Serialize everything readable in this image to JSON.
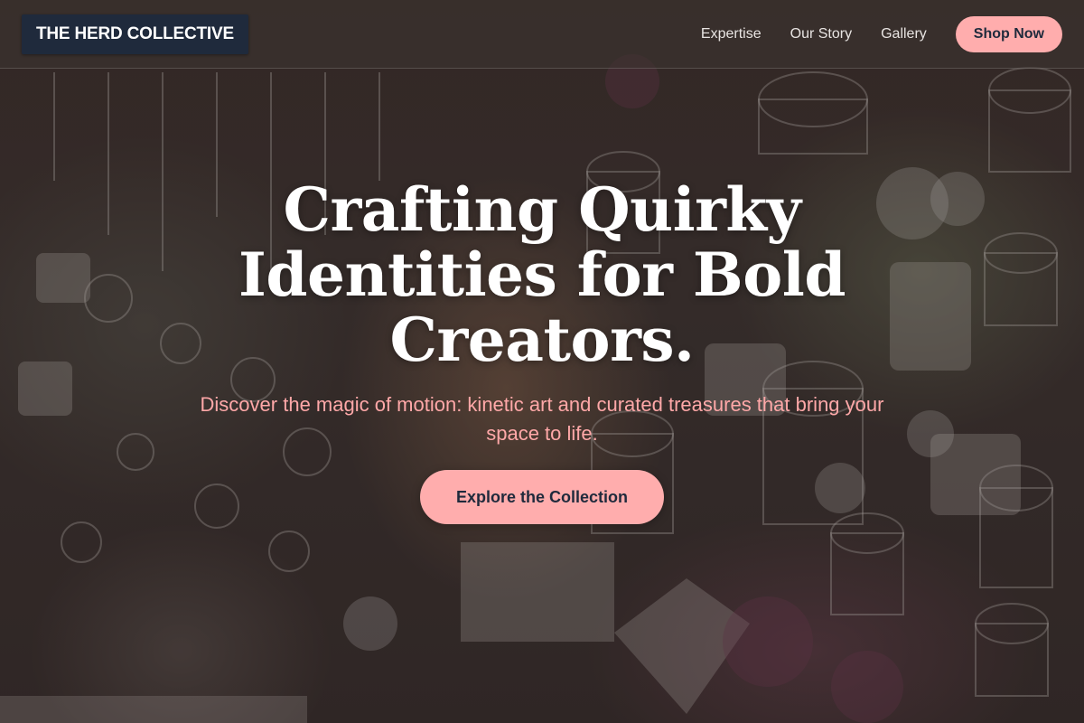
{
  "brand": {
    "name": "THE HERD COLLECTIVE",
    "accent_color": "#ffadad",
    "dark_color": "#1f2a3c"
  },
  "nav": {
    "links": [
      {
        "label": "Expertise"
      },
      {
        "label": "Our Story"
      },
      {
        "label": "Gallery"
      }
    ],
    "shop_label": "Shop Now"
  },
  "hero": {
    "headline": "Crafting Quirky Identities for Bold Creators.",
    "subtitle": "Discover the magic of motion: kinetic art and curated treasures that bring your space to life.",
    "cta_label": "Explore the Collection",
    "background_description": "Blurred shop interior with hanging birdcages, watering cans and flowers"
  }
}
